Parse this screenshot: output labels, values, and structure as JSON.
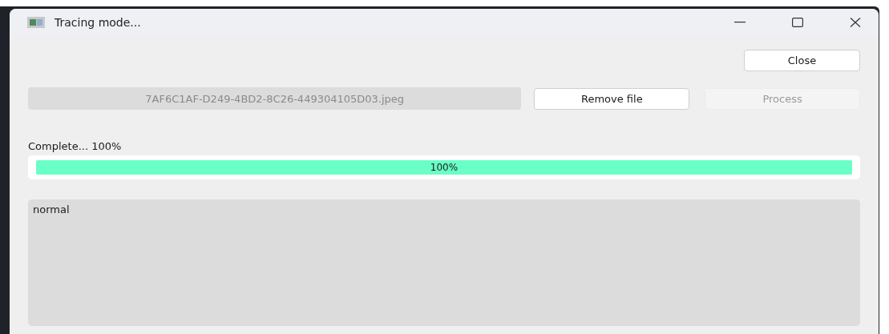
{
  "window": {
    "title": "Tracing mode..."
  },
  "close_button": {
    "label": "Close",
    "disabled": false
  },
  "file_field": {
    "value": "7AF6C1AF-D249-4BD2-8C26-449304105D03.jpeg",
    "disabled": true
  },
  "buttons": [
    {
      "label": "Remove file",
      "disabled": false
    },
    {
      "label": "Process",
      "disabled": true
    }
  ],
  "status": "Complete... 100%",
  "progress": {
    "level": 1,
    "reading": "100%"
  },
  "output": {
    "value": "normal"
  }
}
